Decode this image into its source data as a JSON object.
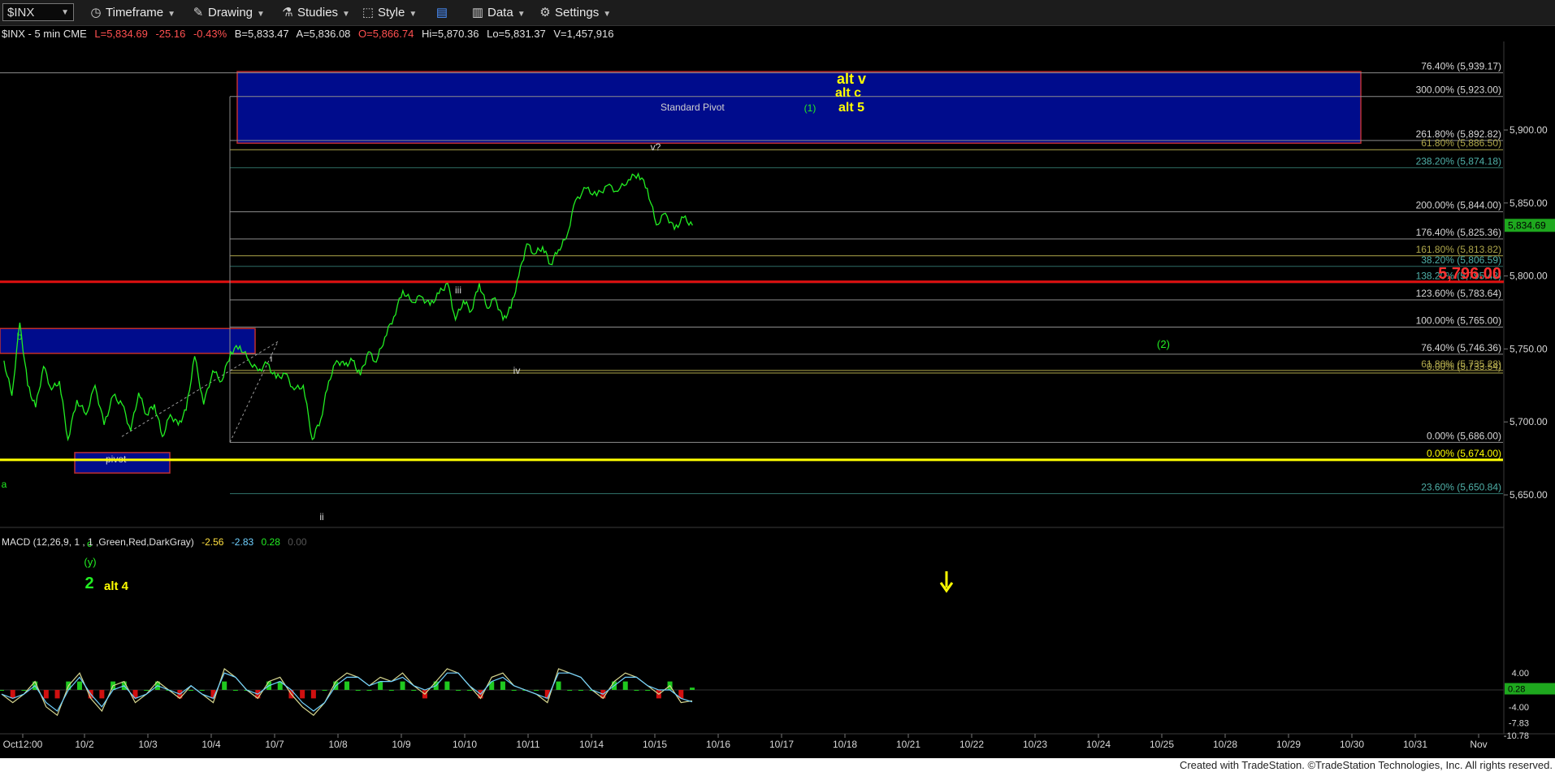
{
  "toolbar": {
    "symbol": "$INX",
    "items": [
      {
        "name": "timeframe",
        "label": "Timeframe",
        "icon": "clock-icon"
      },
      {
        "name": "drawing",
        "label": "Drawing",
        "icon": "pencil-icon"
      },
      {
        "name": "studies",
        "label": "Studies",
        "icon": "flask-icon"
      },
      {
        "name": "style",
        "label": "Style",
        "icon": "style-icon"
      },
      {
        "name": "layout",
        "label": "",
        "icon": "layout-icon"
      },
      {
        "name": "data",
        "label": "Data",
        "icon": "bar-chart-icon"
      },
      {
        "name": "settings",
        "label": "Settings",
        "icon": "gear-icon"
      }
    ]
  },
  "colors": {
    "price": "#22ee22",
    "pivot_fill": "#000c8c",
    "pivot_border": "#c03030",
    "red_line": "#e01010",
    "yellow_line": "#ffff00",
    "level_line": "#8d8d8d",
    "teal_line": "#2e6e66",
    "label_gray": "#d8d8d8",
    "label_teal": "#4fb0a8",
    "label_olive": "#b0a84c",
    "macd_line": "#d8d890",
    "signal_line": "#6fd0ff",
    "hist_pos": "#1fc81f",
    "hist_neg": "#d01010"
  },
  "header": {
    "symbol": "$INX - 5 min  CME",
    "last": "L=5,834.69",
    "change": "-25.16",
    "pct": "-0.43%",
    "bid": "B=5,833.47",
    "ask": "A=5,836.08",
    "open": "O=5,866.74",
    "high": "Hi=5,870.36",
    "low": "Lo=5,831.37",
    "volume": "V=1,457,916"
  },
  "macd_header": {
    "name": "MACD (12,26,9, 1 , 1 ,Green,Red,DarkGray)",
    "v1": "-2.56",
    "v2": "-2.83",
    "v3": "0.28",
    "v4": "0.00"
  },
  "footer": "Created with TradeStation. ©TradeStation Technologies, Inc. All rights reserved.",
  "chart_data": {
    "type": "line",
    "title": "$INX - 5 min",
    "ylim": [
      5628,
      5956
    ],
    "y_ticks": [
      "5,650.00",
      "5,700.00",
      "5,750.00",
      "5,800.00",
      "5,850.00",
      "5,900.00"
    ],
    "x_ticks": [
      "Oct12:00",
      "10/2",
      "10/3",
      "10/4",
      "10/7",
      "10/8",
      "10/9",
      "10/10",
      "10/11",
      "10/14",
      "10/15",
      "10/16",
      "10/17",
      "10/18",
      "10/21",
      "10/22",
      "10/23",
      "10/24",
      "10/25",
      "10/28",
      "10/29",
      "10/30",
      "10/31",
      "Nov"
    ],
    "last_price_tag": "5,834.69",
    "big_level_tag": "5,796.00",
    "series": [
      {
        "values": [
          {
            "t": "10/1",
            "p": 5742
          },
          {
            "t": "10/1",
            "p": 5718
          },
          {
            "t": "10/1",
            "p": 5768
          },
          {
            "t": "10/1",
            "p": 5725
          },
          {
            "t": "10/1",
            "p": 5710
          },
          {
            "t": "10/1",
            "p": 5738
          },
          {
            "t": "10/1",
            "p": 5722
          },
          {
            "t": "10/1",
            "p": 5728
          },
          {
            "t": "10/2",
            "p": 5688
          },
          {
            "t": "10/2",
            "p": 5715
          },
          {
            "t": "10/2",
            "p": 5705
          },
          {
            "t": "10/2",
            "p": 5725
          },
          {
            "t": "10/2",
            "p": 5698
          },
          {
            "t": "10/2",
            "p": 5718
          },
          {
            "t": "10/2",
            "p": 5712
          },
          {
            "t": "10/3",
            "p": 5694
          },
          {
            "t": "10/3",
            "p": 5720
          },
          {
            "t": "10/3",
            "p": 5705
          },
          {
            "t": "10/3",
            "p": 5712
          },
          {
            "t": "10/3",
            "p": 5690
          },
          {
            "t": "10/3",
            "p": 5705
          },
          {
            "t": "10/3",
            "p": 5698
          },
          {
            "t": "10/3",
            "p": 5708
          },
          {
            "t": "10/4",
            "p": 5745
          },
          {
            "t": "10/4",
            "p": 5712
          },
          {
            "t": "10/4",
            "p": 5735
          },
          {
            "t": "10/4",
            "p": 5728
          },
          {
            "t": "10/4",
            "p": 5748
          },
          {
            "t": "10/4",
            "p": 5752
          },
          {
            "t": "10/4",
            "p": 5742
          },
          {
            "t": "10/7",
            "p": 5735
          },
          {
            "t": "10/7",
            "p": 5740
          },
          {
            "t": "10/7",
            "p": 5730
          },
          {
            "t": "10/7",
            "p": 5733
          },
          {
            "t": "10/7",
            "p": 5722
          },
          {
            "t": "10/7",
            "p": 5725
          },
          {
            "t": "10/7",
            "p": 5688
          },
          {
            "t": "10/8",
            "p": 5702
          },
          {
            "t": "10/8",
            "p": 5728
          },
          {
            "t": "10/8",
            "p": 5742
          },
          {
            "t": "10/8",
            "p": 5739
          },
          {
            "t": "10/8",
            "p": 5742
          },
          {
            "t": "10/8",
            "p": 5732
          },
          {
            "t": "10/8",
            "p": 5748
          },
          {
            "t": "10/8",
            "p": 5741
          },
          {
            "t": "10/9",
            "p": 5758
          },
          {
            "t": "10/9",
            "p": 5772
          },
          {
            "t": "10/9",
            "p": 5790
          },
          {
            "t": "10/9",
            "p": 5782
          },
          {
            "t": "10/9",
            "p": 5786
          },
          {
            "t": "10/9",
            "p": 5780
          },
          {
            "t": "10/9",
            "p": 5788
          },
          {
            "t": "10/10",
            "p": 5795
          },
          {
            "t": "10/10",
            "p": 5770
          },
          {
            "t": "10/10",
            "p": 5783
          },
          {
            "t": "10/10",
            "p": 5776
          },
          {
            "t": "10/10",
            "p": 5795
          },
          {
            "t": "10/10",
            "p": 5778
          },
          {
            "t": "10/10",
            "p": 5785
          },
          {
            "t": "10/10",
            "p": 5770
          },
          {
            "t": "10/11",
            "p": 5778
          },
          {
            "t": "10/11",
            "p": 5800
          },
          {
            "t": "10/11",
            "p": 5822
          },
          {
            "t": "10/11",
            "p": 5815
          },
          {
            "t": "10/11",
            "p": 5820
          },
          {
            "t": "10/11",
            "p": 5808
          },
          {
            "t": "10/11",
            "p": 5818
          },
          {
            "t": "10/11",
            "p": 5826
          },
          {
            "t": "10/14",
            "p": 5852
          },
          {
            "t": "10/14",
            "p": 5860
          },
          {
            "t": "10/14",
            "p": 5855
          },
          {
            "t": "10/14",
            "p": 5862
          },
          {
            "t": "10/14",
            "p": 5858
          },
          {
            "t": "10/14",
            "p": 5866
          },
          {
            "t": "10/15",
            "p": 5870
          },
          {
            "t": "10/15",
            "p": 5860
          },
          {
            "t": "10/15",
            "p": 5835
          },
          {
            "t": "10/15",
            "p": 5843
          },
          {
            "t": "10/15",
            "p": 5832
          },
          {
            "t": "10/15",
            "p": 5840
          },
          {
            "t": "10/15",
            "p": 5834.69
          }
        ]
      }
    ],
    "levels": [
      {
        "label": "76.40% (5,939.17)",
        "value": 5939.17,
        "style": "gray"
      },
      {
        "label": "300.00% (5,923.00)",
        "value": 5923.0,
        "style": "gray"
      },
      {
        "label": "261.80% (5,892.82)",
        "value": 5892.82,
        "style": "gray"
      },
      {
        "label": "61.80% (5,886.50)",
        "value": 5886.5,
        "style": "olive"
      },
      {
        "label": "238.20% (5,874.18)",
        "value": 5874.18,
        "style": "teal"
      },
      {
        "label": "200.00% (5,844.00)",
        "value": 5844.0,
        "style": "gray"
      },
      {
        "label": "176.40% (5,825.36)",
        "value": 5825.36,
        "style": "gray"
      },
      {
        "label": "161.80% (5,813.82)",
        "value": 5813.82,
        "style": "olive"
      },
      {
        "label": "38.20% (5,806.59)",
        "value": 5806.59,
        "style": "teal"
      },
      {
        "label": "138.20% (5,795.48)",
        "value": 5795.48,
        "style": "teal"
      },
      {
        "label": "123.60% (5,783.64)",
        "value": 5783.64,
        "style": "gray"
      },
      {
        "label": "100.00% (5,765.00)",
        "value": 5765.0,
        "style": "gray"
      },
      {
        "label": "76.40% (5,746.36)",
        "value": 5746.36,
        "style": "gray"
      },
      {
        "label": "61.80% (5,735.28)",
        "value": 5735.28,
        "style": "olive"
      },
      {
        "label": "0.00% (5,733.54)",
        "value": 5733.54,
        "style": "olive"
      },
      {
        "label": "0.00% (5,686.00)",
        "value": 5686.0,
        "style": "gray"
      },
      {
        "label": "0.00% (5,674.00)",
        "value": 5674.0,
        "style": "yellow"
      },
      {
        "label": "23.60% (5,650.84)",
        "value": 5650.84,
        "style": "teal"
      }
    ],
    "zones": [
      {
        "label": "Standard Pivot",
        "top": 5940,
        "bottom": 5891
      },
      {
        "label": "",
        "top": 5764,
        "bottom": 5747
      },
      {
        "label": "pivot",
        "top": 5679,
        "bottom": 5665
      }
    ],
    "wave_labels": [
      {
        "text": "b",
        "color": "green"
      },
      {
        "text": "a",
        "color": "green"
      },
      {
        "text": "c",
        "color": "green"
      },
      {
        "text": "(y)",
        "color": "green"
      },
      {
        "text": "2",
        "color": "green"
      },
      {
        "text": "alt 4",
        "color": "yellow"
      },
      {
        "text": "i",
        "color": "gray"
      },
      {
        "text": "ii",
        "color": "gray"
      },
      {
        "text": "iii",
        "color": "gray"
      },
      {
        "text": "iv",
        "color": "gray"
      },
      {
        "text": "v?",
        "color": "gray"
      },
      {
        "text": "(1)",
        "color": "green"
      },
      {
        "text": "(2)",
        "color": "green"
      },
      {
        "text": "alt v",
        "color": "yellow"
      },
      {
        "text": "alt c",
        "color": "yellow"
      },
      {
        "text": "alt 5",
        "color": "yellow"
      }
    ],
    "macd": {
      "ylim": [
        -11,
        6
      ],
      "y_ticks": [
        "4.00",
        "-4.00",
        "-7.83",
        "-10.78"
      ],
      "hist_tag": "0.28",
      "macd_values": [
        -1,
        -3,
        -1,
        2,
        -4,
        -6,
        1,
        4,
        -2,
        -5,
        1,
        2,
        -3,
        -1,
        2,
        0,
        -2,
        1,
        -1,
        -3,
        5,
        3,
        0,
        -2,
        2,
        3,
        -1,
        -4,
        -6,
        -3,
        2,
        4,
        3,
        1,
        3,
        2,
        4,
        1,
        -1,
        2,
        5,
        4,
        1,
        -2,
        3,
        4,
        1,
        0,
        -1,
        -3,
        5,
        4,
        3,
        0,
        -2,
        2,
        4,
        3,
        1,
        -1,
        1,
        -3,
        -2.56
      ],
      "signal_values": [
        -1,
        -2,
        -1,
        1,
        -3,
        -5,
        0,
        3,
        -1,
        -4,
        0,
        1,
        -2,
        -1,
        1,
        0,
        -1,
        1,
        -1,
        -2,
        4,
        3,
        0,
        -1,
        1,
        2,
        0,
        -3,
        -5,
        -3,
        1,
        3,
        3,
        1,
        2,
        2,
        3,
        1,
        0,
        1,
        4,
        4,
        1,
        -1,
        2,
        3,
        1,
        0,
        -1,
        -2,
        4,
        4,
        3,
        0,
        -1,
        1,
        3,
        3,
        1,
        0,
        0,
        -2,
        -2.83
      ]
    }
  }
}
